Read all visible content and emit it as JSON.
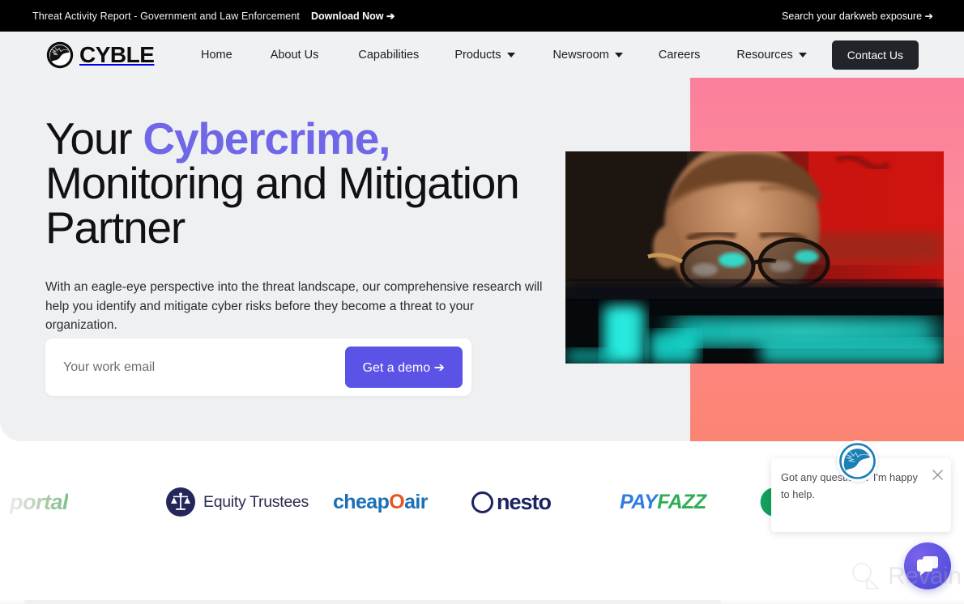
{
  "topbar": {
    "announcement": "Threat Activity Report - Government and Law Enforcement",
    "download_link": "Download Now ➔",
    "search_link": "Search your darkweb exposure ➔"
  },
  "nav": {
    "brand": "CYBLE",
    "brand_icon": "cyble-eagle-globe-icon",
    "items": [
      {
        "label": "Home",
        "has_caret": false
      },
      {
        "label": "About Us",
        "has_caret": false
      },
      {
        "label": "Capabilities",
        "has_caret": false
      },
      {
        "label": "Products",
        "has_caret": true
      },
      {
        "label": "Newsroom",
        "has_caret": true
      },
      {
        "label": "Careers",
        "has_caret": false
      },
      {
        "label": "Resources",
        "has_caret": true
      }
    ],
    "contact_label": "Contact Us"
  },
  "hero": {
    "headline_part1": "Your ",
    "headline_accent": "Cybercrime,",
    "headline_part2": "Monitoring and Mitigation Partner",
    "subcopy": "With an eagle-eye perspective into the threat landscape, our comprehensive research will help you identify and mitigate cyber risks before they become a threat to your organization.",
    "email_placeholder": "Your work email",
    "email_value": "",
    "cta_label": "Get a demo ➔",
    "photo_alt": "man-with-glasses-at-screen-photo",
    "accent_color": "#6f66e8",
    "cta_color": "#5b52e6",
    "panel_gradient_from": "#fb7f9c",
    "panel_gradient_to": "#fc8472"
  },
  "clients": [
    {
      "name": "portal",
      "icon": "portal-wordmark"
    },
    {
      "name": "Equity Trustees",
      "icon": "scales-of-justice-icon"
    },
    {
      "name": "cheapOair",
      "icon": "suitcase-icon"
    },
    {
      "name": "nesto",
      "icon": "circle-icon"
    },
    {
      "name": "PAYFAZZ",
      "icon": "lightning-bolt-icon"
    },
    {
      "name": "",
      "icon": "partial-green-logo-icon"
    }
  ],
  "client_parts": {
    "cheap_prefix": "cheap",
    "cheap_o": "O",
    "cheap_suffix": "air",
    "nesto_word": "nesto",
    "pay_word": "PAY",
    "fazz_word": "FAZZ"
  },
  "chat": {
    "message": "Got any questions? I'm happy to help.",
    "avatar_icon": "cyble-eagle-avatar-icon",
    "close_icon": "close-icon",
    "fab_icon": "chat-bubbles-icon"
  },
  "watermark": {
    "text": "Revain",
    "icon": "revain-magnifier-icon"
  }
}
